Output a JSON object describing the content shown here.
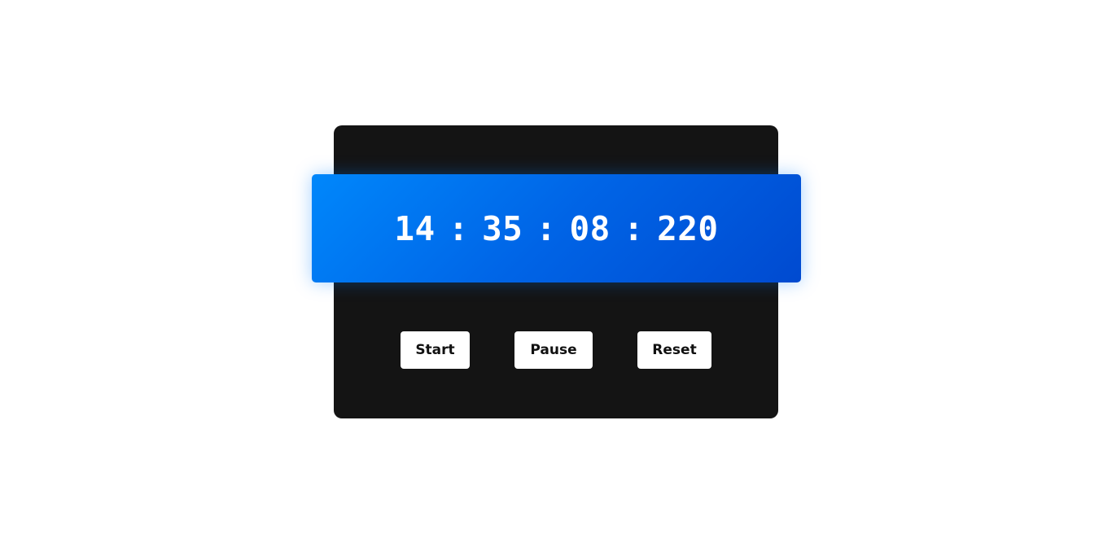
{
  "timer": {
    "hours": "14",
    "minutes": "35",
    "seconds": "08",
    "milliseconds": "220",
    "separator": ":"
  },
  "controls": {
    "start_label": "Start",
    "pause_label": "Pause",
    "reset_label": "Reset"
  },
  "colors": {
    "page_background": "#ffffff",
    "card_background": "#141414",
    "display_gradient_start": "#0087fb",
    "display_gradient_end": "#004ad0",
    "button_background": "#ffffff",
    "button_text": "#111111",
    "time_text": "#ffffff"
  }
}
